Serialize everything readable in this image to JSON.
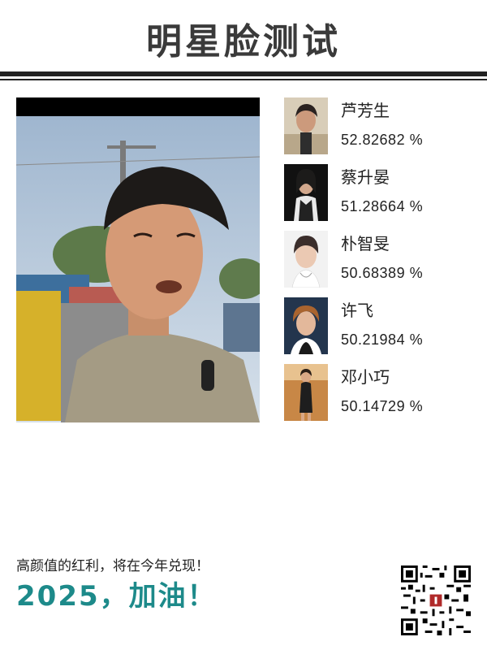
{
  "header": {
    "title": "明星脸测试"
  },
  "matches": [
    {
      "name": "芦芳生",
      "score": "52.82682 %"
    },
    {
      "name": "蔡升晏",
      "score": "51.28664 %"
    },
    {
      "name": "朴智旻",
      "score": "50.68389 %"
    },
    {
      "name": "许飞",
      "score": "50.21984 %"
    },
    {
      "name": "邓小巧",
      "score": "50.14729 %"
    }
  ],
  "footer": {
    "tagline": "高颜值的红利，将在今年兑现！",
    "slogan": "2025，加油！"
  },
  "colors": {
    "slogan": "#1d8a8a",
    "rules": "#222222"
  }
}
